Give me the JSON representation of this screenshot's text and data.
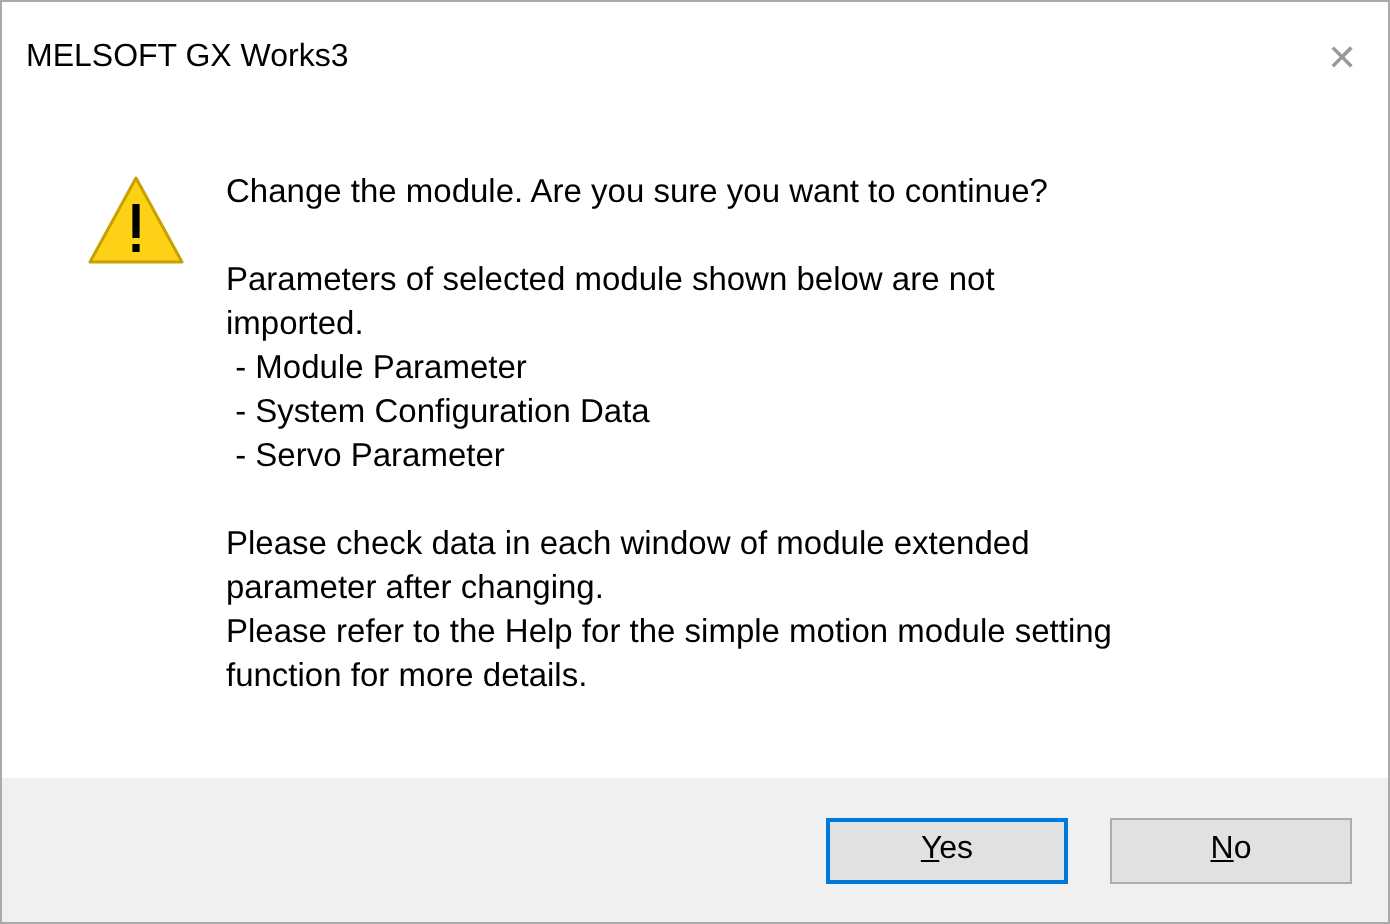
{
  "window": {
    "title": "MELSOFT GX Works3",
    "close": "✕"
  },
  "message": {
    "kind": "warning",
    "paragraphs": [
      [
        "Change the module. Are you sure you want to continue?"
      ],
      [
        "Parameters of selected module shown below are not",
        "imported.",
        " - Module Parameter",
        " - System Configuration Data",
        " - Servo Parameter"
      ],
      [
        "Please check data in each window of module extended",
        "parameter after changing.",
        "Please refer to the Help for the simple motion module setting",
        "function for more details."
      ]
    ]
  },
  "buttons": [
    {
      "label": "Yes",
      "mnemonic": true,
      "default": true
    },
    {
      "label": "No",
      "mnemonic": true,
      "default": false
    }
  ]
}
